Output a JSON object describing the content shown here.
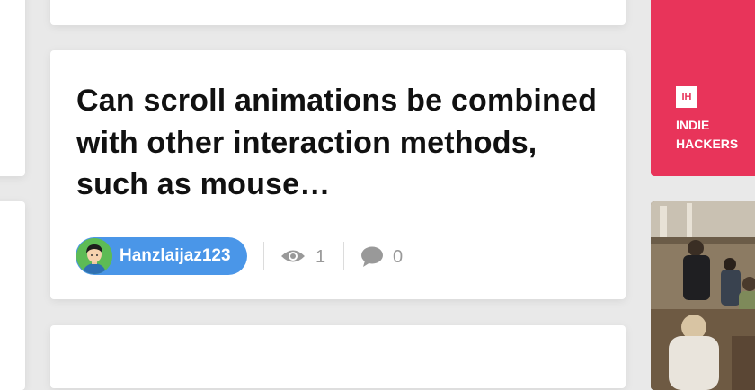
{
  "post": {
    "title": "Can scroll animations be combined with other interaction methods, such as mouse…",
    "author": "Hanzlaijaz123",
    "views": "1",
    "comments": "0"
  },
  "sidebar_ad": {
    "logo": "IH",
    "text": "INDIE\nHACKERS",
    "color": "#e8345a"
  },
  "icons": {
    "views": "eye-icon",
    "comments": "comment-icon"
  },
  "colors": {
    "author_pill": "#4a96e8",
    "muted": "#999999"
  }
}
